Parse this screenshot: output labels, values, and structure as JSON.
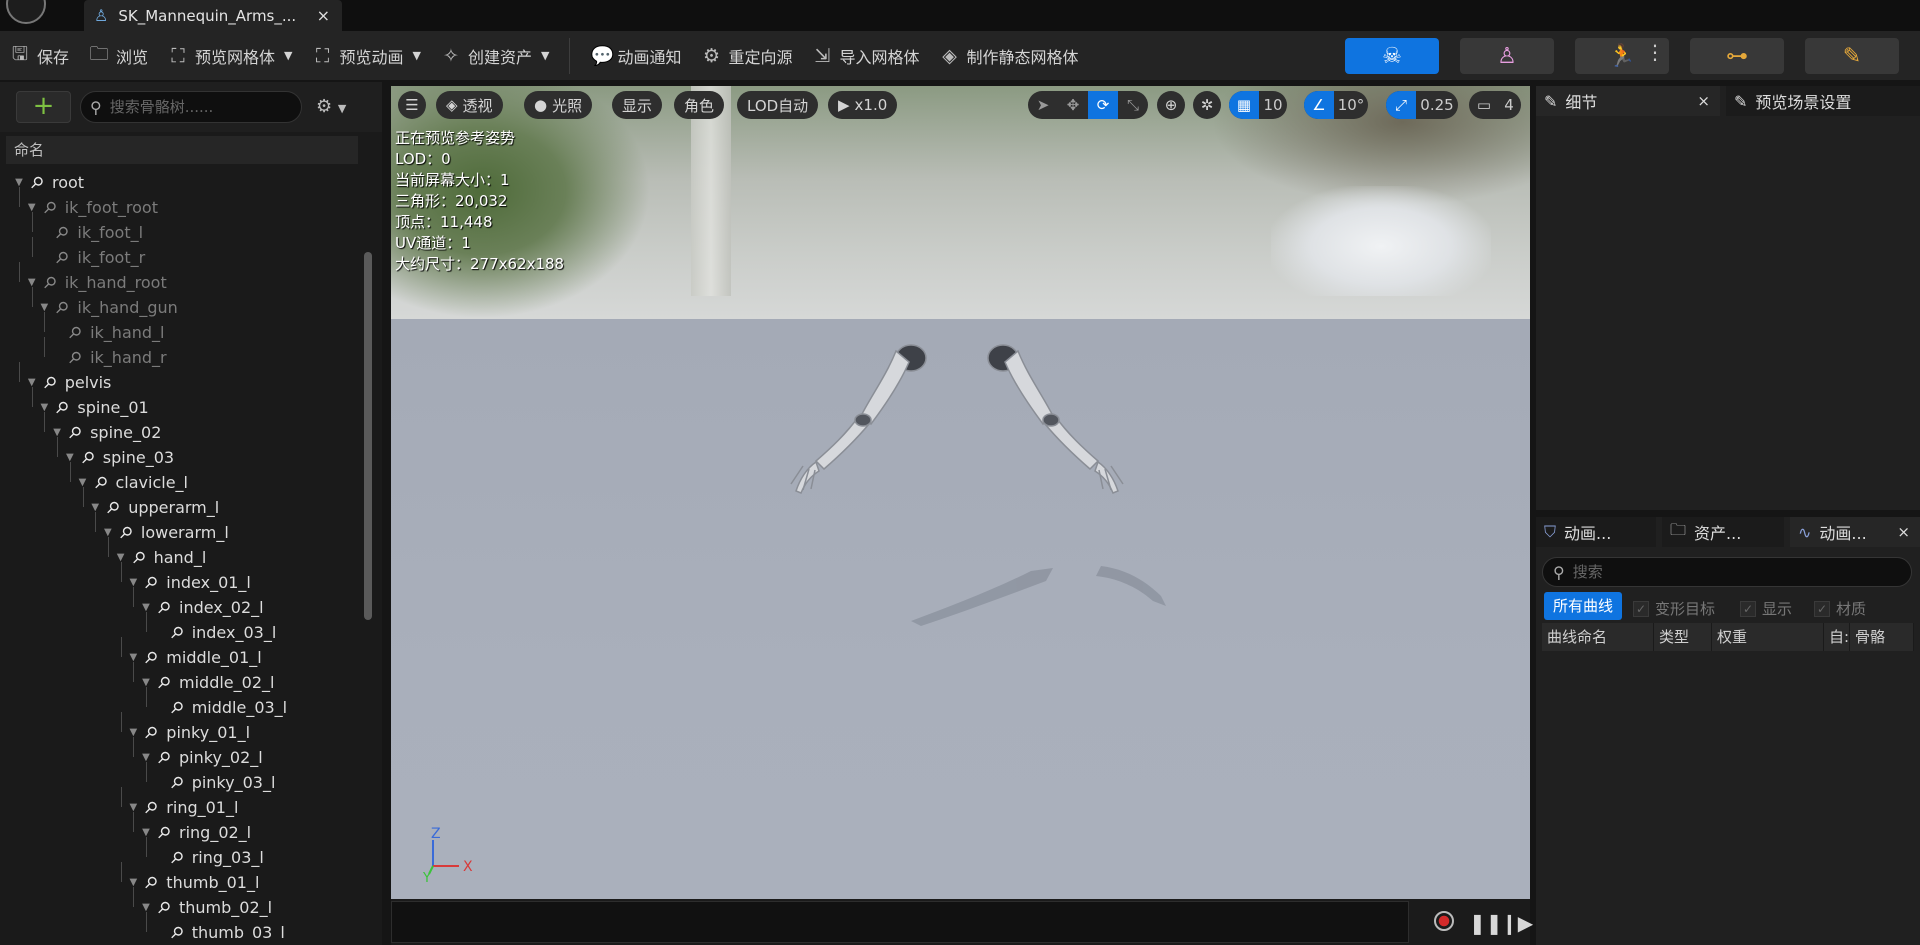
{
  "tab": {
    "title": "SK_Mannequin_Arms_...",
    "close": "×"
  },
  "toolbar": {
    "save": "保存",
    "browse": "浏览",
    "preview_mesh": "预览网格体",
    "preview_anim": "预览动画",
    "create_asset": "创建资产",
    "anim_notify": "动画通知",
    "retarget_source": "重定向源",
    "import_mesh": "导入网格体",
    "make_static_mesh": "制作静态网格体"
  },
  "skeleton_tree": {
    "search_placeholder": "搜索骨骼树......",
    "column_name": "命名",
    "bones": [
      {
        "name": "root",
        "depth": 0,
        "virtual": false
      },
      {
        "name": "ik_foot_root",
        "depth": 1,
        "virtual": true
      },
      {
        "name": "ik_foot_l",
        "depth": 2,
        "virtual": true
      },
      {
        "name": "ik_foot_r",
        "depth": 2,
        "virtual": true
      },
      {
        "name": "ik_hand_root",
        "depth": 1,
        "virtual": true
      },
      {
        "name": "ik_hand_gun",
        "depth": 2,
        "virtual": true
      },
      {
        "name": "ik_hand_l",
        "depth": 3,
        "virtual": true
      },
      {
        "name": "ik_hand_r",
        "depth": 3,
        "virtual": true
      },
      {
        "name": "pelvis",
        "depth": 1,
        "virtual": false
      },
      {
        "name": "spine_01",
        "depth": 2,
        "virtual": false
      },
      {
        "name": "spine_02",
        "depth": 3,
        "virtual": false
      },
      {
        "name": "spine_03",
        "depth": 4,
        "virtual": false
      },
      {
        "name": "clavicle_l",
        "depth": 5,
        "virtual": false
      },
      {
        "name": "upperarm_l",
        "depth": 6,
        "virtual": false
      },
      {
        "name": "lowerarm_l",
        "depth": 7,
        "virtual": false
      },
      {
        "name": "hand_l",
        "depth": 8,
        "virtual": false
      },
      {
        "name": "index_01_l",
        "depth": 9,
        "virtual": false
      },
      {
        "name": "index_02_l",
        "depth": 10,
        "virtual": false
      },
      {
        "name": "index_03_l",
        "depth": 11,
        "virtual": false
      },
      {
        "name": "middle_01_l",
        "depth": 9,
        "virtual": false
      },
      {
        "name": "middle_02_l",
        "depth": 10,
        "virtual": false
      },
      {
        "name": "middle_03_l",
        "depth": 11,
        "virtual": false
      },
      {
        "name": "pinky_01_l",
        "depth": 9,
        "virtual": false
      },
      {
        "name": "pinky_02_l",
        "depth": 10,
        "virtual": false
      },
      {
        "name": "pinky_03_l",
        "depth": 11,
        "virtual": false
      },
      {
        "name": "ring_01_l",
        "depth": 9,
        "virtual": false
      },
      {
        "name": "ring_02_l",
        "depth": 10,
        "virtual": false
      },
      {
        "name": "ring_03_l",
        "depth": 11,
        "virtual": false
      },
      {
        "name": "thumb_01_l",
        "depth": 9,
        "virtual": false
      },
      {
        "name": "thumb_02_l",
        "depth": 10,
        "virtual": false
      },
      {
        "name": "thumb_03_l",
        "depth": 11,
        "virtual": false
      }
    ]
  },
  "viewport": {
    "perspective": "透视",
    "lighting": "光照",
    "show": "显示",
    "character": "角色",
    "lod": "LOD自动",
    "speed": "x1.0",
    "grid_snap": "10",
    "rotate_snap": "10°",
    "scale_snap": "0.25",
    "camera_speed": "4",
    "stats": [
      "正在预览参考姿势",
      "LOD：0",
      "当前屏幕大小：1",
      "三角形：20,032",
      "顶点：11,448",
      "UV通道：1",
      "大约尺寸：277x62x188"
    ],
    "axis_z": "Z",
    "axis_x": "X",
    "axis_y": "Y"
  },
  "right_top": {
    "details_tab": "细节",
    "scene_tab": "预览场景设置",
    "close": "×"
  },
  "right_bottom": {
    "tab1": "动画...",
    "tab2": "资产...",
    "tab3": "动画...",
    "close": "×",
    "search_placeholder": "搜索",
    "all_curves": "所有曲线",
    "morph_targets": "变形目标",
    "show": "显示",
    "material": "材质",
    "columns": [
      "曲线命名",
      "类型",
      "权重",
      "自:",
      "骨骼"
    ]
  },
  "colors": {
    "accent": "#0f74e0",
    "add_green": "#7ec142",
    "record_red": "#d32a2a"
  }
}
